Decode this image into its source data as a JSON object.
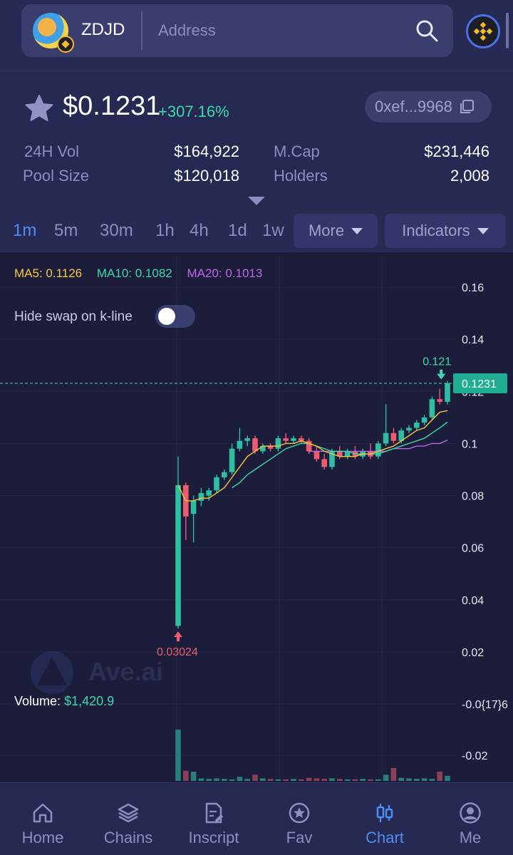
{
  "header": {
    "token_symbol": "ZDJD",
    "address_placeholder": "Address"
  },
  "price_info": {
    "price": "$0.1231",
    "change": "+307.16%",
    "contract": "0xef...9968",
    "stats": {
      "vol_label": "24H Vol",
      "vol_value": "$164,922",
      "mcap_label": "M.Cap",
      "mcap_value": "$231,446",
      "pool_label": "Pool Size",
      "pool_value": "$120,018",
      "holders_label": "Holders",
      "holders_value": "2,008"
    }
  },
  "timeframes": [
    "1m",
    "5m",
    "30m",
    "1h",
    "4h",
    "1d",
    "1w"
  ],
  "active_timeframe": "1m",
  "more_label": "More",
  "indicators_label": "Indicators",
  "chart": {
    "ma_legend": {
      "ma5": "MA5: 0.1126",
      "ma10": "MA10: 0.1082",
      "ma20": "MA20: 0.1013"
    },
    "hide_swap_label": "Hide swap on k-line",
    "hide_swap_enabled": false,
    "watermark": "Ave.ai",
    "volume_label": "Volume:",
    "volume_value": "$1,420.9",
    "low_marker": "0.03024",
    "high_marker": "0.121",
    "current_price_tag": "0.1231",
    "price_axis": [
      "0.16",
      "0.14",
      "0.12",
      "0.1",
      "0.08",
      "0.06",
      "0.04",
      "0.02",
      "-0.0{17}6",
      "-0.02"
    ]
  },
  "chart_data": {
    "type": "candlestick",
    "title": "",
    "ylim": [
      -0.025,
      0.165
    ],
    "series_colors": {
      "up": "#2fbfa0",
      "down": "#ef5b6e",
      "ma5": "#f5c842",
      "ma10": "#3fd8a8",
      "ma20": "#c065e8"
    },
    "candles": [
      {
        "o": 0.03,
        "h": 0.095,
        "l": 0.029,
        "c": 0.084
      },
      {
        "o": 0.084,
        "h": 0.085,
        "l": 0.063,
        "c": 0.072
      },
      {
        "o": 0.073,
        "h": 0.08,
        "l": 0.062,
        "c": 0.078
      },
      {
        "o": 0.078,
        "h": 0.083,
        "l": 0.076,
        "c": 0.081
      },
      {
        "o": 0.08,
        "h": 0.083,
        "l": 0.078,
        "c": 0.082
      },
      {
        "o": 0.082,
        "h": 0.088,
        "l": 0.081,
        "c": 0.087
      },
      {
        "o": 0.087,
        "h": 0.09,
        "l": 0.086,
        "c": 0.089
      },
      {
        "o": 0.089,
        "h": 0.1,
        "l": 0.088,
        "c": 0.098
      },
      {
        "o": 0.098,
        "h": 0.106,
        "l": 0.097,
        "c": 0.101
      },
      {
        "o": 0.101,
        "h": 0.103,
        "l": 0.099,
        "c": 0.102
      },
      {
        "o": 0.102,
        "h": 0.103,
        "l": 0.096,
        "c": 0.097
      },
      {
        "o": 0.097,
        "h": 0.1,
        "l": 0.096,
        "c": 0.099
      },
      {
        "o": 0.099,
        "h": 0.1,
        "l": 0.097,
        "c": 0.098
      },
      {
        "o": 0.098,
        "h": 0.103,
        "l": 0.097,
        "c": 0.102
      },
      {
        "o": 0.102,
        "h": 0.104,
        "l": 0.1,
        "c": 0.101
      },
      {
        "o": 0.101,
        "h": 0.103,
        "l": 0.1,
        "c": 0.102
      },
      {
        "o": 0.102,
        "h": 0.103,
        "l": 0.1,
        "c": 0.101
      },
      {
        "o": 0.101,
        "h": 0.102,
        "l": 0.096,
        "c": 0.097
      },
      {
        "o": 0.097,
        "h": 0.099,
        "l": 0.093,
        "c": 0.094
      },
      {
        "o": 0.094,
        "h": 0.096,
        "l": 0.09,
        "c": 0.091
      },
      {
        "o": 0.091,
        "h": 0.098,
        "l": 0.09,
        "c": 0.097
      },
      {
        "o": 0.097,
        "h": 0.099,
        "l": 0.094,
        "c": 0.095
      },
      {
        "o": 0.095,
        "h": 0.098,
        "l": 0.094,
        "c": 0.097
      },
      {
        "o": 0.097,
        "h": 0.099,
        "l": 0.094,
        "c": 0.095
      },
      {
        "o": 0.095,
        "h": 0.098,
        "l": 0.094,
        "c": 0.097
      },
      {
        "o": 0.097,
        "h": 0.1,
        "l": 0.094,
        "c": 0.095
      },
      {
        "o": 0.095,
        "h": 0.101,
        "l": 0.094,
        "c": 0.1
      },
      {
        "o": 0.1,
        "h": 0.115,
        "l": 0.099,
        "c": 0.104
      },
      {
        "o": 0.104,
        "h": 0.106,
        "l": 0.1,
        "c": 0.101
      },
      {
        "o": 0.101,
        "h": 0.106,
        "l": 0.1,
        "c": 0.105
      },
      {
        "o": 0.105,
        "h": 0.107,
        "l": 0.104,
        "c": 0.106
      },
      {
        "o": 0.106,
        "h": 0.109,
        "l": 0.105,
        "c": 0.108
      },
      {
        "o": 0.108,
        "h": 0.111,
        "l": 0.107,
        "c": 0.11
      },
      {
        "o": 0.11,
        "h": 0.118,
        "l": 0.109,
        "c": 0.117
      },
      {
        "o": 0.117,
        "h": 0.121,
        "l": 0.115,
        "c": 0.116
      },
      {
        "o": 0.116,
        "h": 0.124,
        "l": 0.115,
        "c": 0.1231
      }
    ],
    "ma5": [
      0.084,
      0.078,
      0.078,
      0.079,
      0.079,
      0.081,
      0.083,
      0.087,
      0.091,
      0.095,
      0.097,
      0.099,
      0.099,
      0.099,
      0.1,
      0.1,
      0.101,
      0.1,
      0.099,
      0.097,
      0.096,
      0.095,
      0.095,
      0.095,
      0.096,
      0.096,
      0.097,
      0.098,
      0.099,
      0.101,
      0.103,
      0.105,
      0.106,
      0.109,
      0.112,
      0.1126
    ],
    "ma10": [
      null,
      null,
      null,
      null,
      null,
      null,
      null,
      0.083,
      0.085,
      0.088,
      0.09,
      0.092,
      0.094,
      0.096,
      0.098,
      0.099,
      0.1,
      0.1,
      0.099,
      0.098,
      0.097,
      0.097,
      0.097,
      0.096,
      0.096,
      0.096,
      0.096,
      0.097,
      0.098,
      0.099,
      0.1,
      0.101,
      0.102,
      0.104,
      0.106,
      0.1082
    ],
    "ma20": [
      null,
      null,
      null,
      null,
      null,
      null,
      null,
      null,
      null,
      null,
      null,
      null,
      null,
      null,
      null,
      null,
      null,
      0.097,
      0.097,
      0.097,
      0.097,
      0.097,
      0.097,
      0.097,
      0.097,
      0.097,
      0.097,
      0.097,
      0.098,
      0.098,
      0.098,
      0.099,
      0.099,
      0.1,
      0.1,
      0.1013
    ],
    "volume": [
      1.0,
      0.2,
      0.18,
      0.05,
      0.04,
      0.05,
      0.04,
      0.03,
      0.08,
      0.04,
      0.12,
      0.05,
      0.04,
      0.03,
      0.03,
      0.04,
      0.03,
      0.06,
      0.05,
      0.04,
      0.05,
      0.04,
      0.03,
      0.03,
      0.04,
      0.03,
      0.03,
      0.12,
      0.25,
      0.06,
      0.05,
      0.04,
      0.05,
      0.04,
      0.18,
      0.1
    ]
  },
  "nav": {
    "items": [
      {
        "label": "Home",
        "icon": "home-icon"
      },
      {
        "label": "Chains",
        "icon": "layers-icon"
      },
      {
        "label": "Inscript",
        "icon": "document-edit-icon"
      },
      {
        "label": "Fav",
        "icon": "star-circle-icon"
      },
      {
        "label": "Chart",
        "icon": "candlestick-icon"
      },
      {
        "label": "Me",
        "icon": "user-icon"
      }
    ],
    "active": "Chart"
  }
}
